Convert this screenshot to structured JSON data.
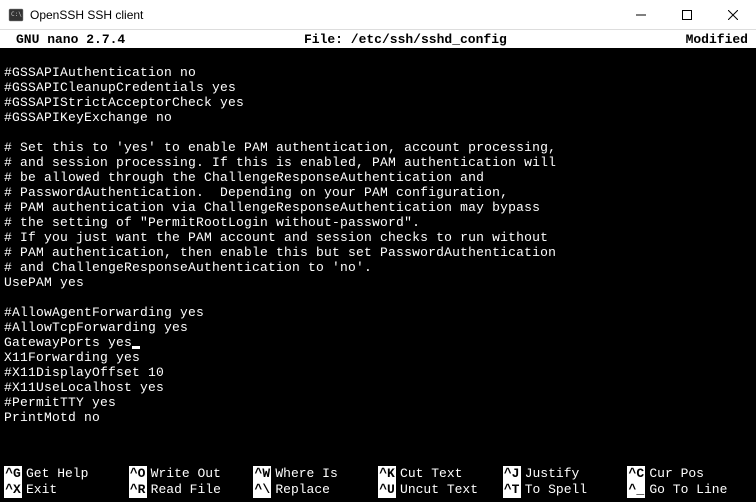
{
  "window": {
    "title": "OpenSSH SSH client"
  },
  "nano": {
    "app_version": "GNU nano 2.7.4",
    "file_label": "File: /etc/ssh/sshd_config",
    "status": "Modified"
  },
  "content": {
    "lines": [
      "",
      "#GSSAPIAuthentication no",
      "#GSSAPICleanupCredentials yes",
      "#GSSAPIStrictAcceptorCheck yes",
      "#GSSAPIKeyExchange no",
      "",
      "# Set this to 'yes' to enable PAM authentication, account processing,",
      "# and session processing. If this is enabled, PAM authentication will",
      "# be allowed through the ChallengeResponseAuthentication and",
      "# PasswordAuthentication.  Depending on your PAM configuration,",
      "# PAM authentication via ChallengeResponseAuthentication may bypass",
      "# the setting of \"PermitRootLogin without-password\".",
      "# If you just want the PAM account and session checks to run without",
      "# PAM authentication, then enable this but set PasswordAuthentication",
      "# and ChallengeResponseAuthentication to 'no'.",
      "UsePAM yes",
      "",
      "#AllowAgentForwarding yes",
      "#AllowTcpForwarding yes",
      "GatewayPorts yes",
      "X11Forwarding yes",
      "#X11DisplayOffset 10",
      "#X11UseLocalhost yes",
      "#PermitTTY yes",
      "PrintMotd no"
    ],
    "cursor_line_index": 19
  },
  "shortcuts": {
    "row1": [
      {
        "key": "^G",
        "label": "Get Help"
      },
      {
        "key": "^O",
        "label": "Write Out"
      },
      {
        "key": "^W",
        "label": "Where Is"
      },
      {
        "key": "^K",
        "label": "Cut Text"
      },
      {
        "key": "^J",
        "label": "Justify"
      },
      {
        "key": "^C",
        "label": "Cur Pos"
      }
    ],
    "row2": [
      {
        "key": "^X",
        "label": "Exit"
      },
      {
        "key": "^R",
        "label": "Read File"
      },
      {
        "key": "^\\",
        "label": "Replace"
      },
      {
        "key": "^U",
        "label": "Uncut Text"
      },
      {
        "key": "^T",
        "label": "To Spell"
      },
      {
        "key": "^_",
        "label": "Go To Line"
      }
    ]
  }
}
